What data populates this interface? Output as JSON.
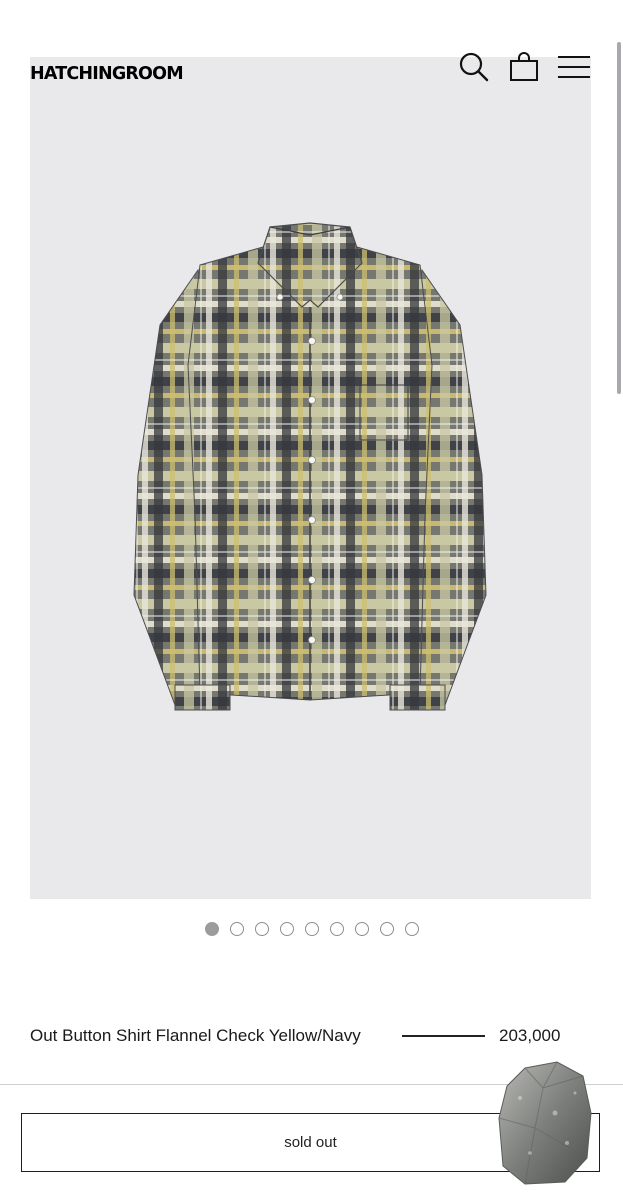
{
  "header": {
    "logo": "HATCHINGROOM",
    "icons": [
      "search-icon",
      "shopping-bag-icon",
      "menu-icon"
    ]
  },
  "gallery": {
    "total_images": 9,
    "active_index": 0
  },
  "product": {
    "name": "Out Button Shirt Flannel Check Yellow/Navy",
    "price": "203,000"
  },
  "purchase": {
    "status_label": "sold out"
  },
  "colors": {
    "image_background": "#e9e9ec",
    "text": "#1a1a1a",
    "dot_active": "#9c9c9c"
  }
}
